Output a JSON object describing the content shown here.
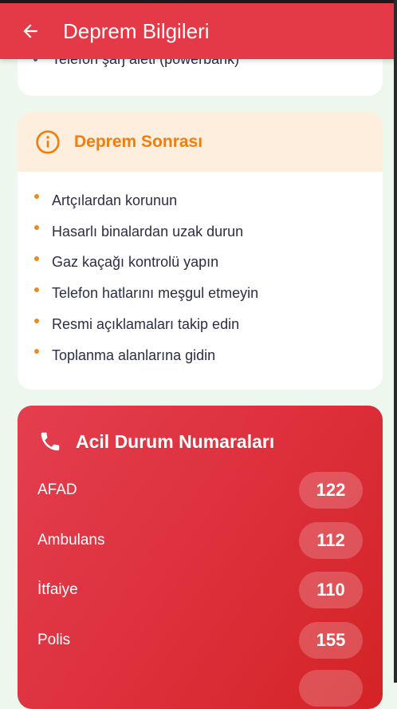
{
  "appbar": {
    "title": "Deprem Bilgileri",
    "back_icon": "arrow-left-icon",
    "color": "#e43a48"
  },
  "previous_card": {
    "last_item": "Telefon şarj aleti (powerbank)"
  },
  "after_earthquake": {
    "title": "Deprem Sonrası",
    "icon": "info-icon",
    "accent": "#f07d0c",
    "items": [
      "Artçılardan korunun",
      "Hasarlı binalardan uzak durun",
      "Gaz kaçağı kontrolü yapın",
      "Telefon hatlarını meşgul etmeyin",
      "Resmi açıklamaları takip edin",
      "Toplanma alanlarına gidin"
    ]
  },
  "emergency": {
    "title": "Acil Durum Numaraları",
    "icon": "phone-icon",
    "numbers": [
      {
        "name": "AFAD",
        "number": "122"
      },
      {
        "name": "Ambulans",
        "number": "112"
      },
      {
        "name": "İtfaiye",
        "number": "110"
      },
      {
        "name": "Polis",
        "number": "155"
      }
    ]
  }
}
